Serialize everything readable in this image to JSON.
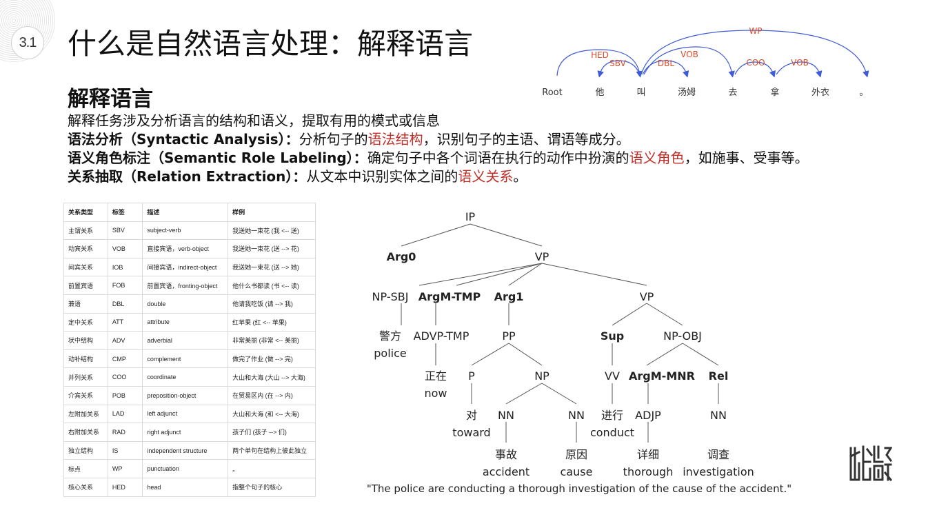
{
  "header": {
    "section_number": "3.1",
    "title": "什么是自然语言处理：解释语言"
  },
  "intro": {
    "heading": "解释语言",
    "line1": "解释任务涉及分析语言的结构和语义，提取有用的模式或信息",
    "syntactic": {
      "label": "语法分析（Syntactic Analysis）：",
      "pre": "分析句子的",
      "highlight": "语法结构",
      "post": "，识别句子的主语、谓语等成分。"
    },
    "srl": {
      "label": "语义角色标注（Semantic Role Labeling）：",
      "pre": "确定句子中各个词语在执行的动作中扮演的",
      "highlight": "语义角色",
      "post": "，如施事、受事等。"
    },
    "relation": {
      "label": "关系抽取（Relation Extraction）：",
      "pre": "从文本中识别实体之间的",
      "highlight": "语义关系",
      "post": "。"
    }
  },
  "dependency_diagram": {
    "tokens": [
      "Root",
      "他",
      "叫",
      "汤姆",
      "去",
      "拿",
      "外衣",
      "。"
    ],
    "arc_labels": [
      "HED",
      "SBV",
      "DBL",
      "VOB",
      "WP",
      "COO",
      "VOB"
    ],
    "colors": {
      "arc": "#3f5bd6",
      "label": "#d94a2a"
    }
  },
  "relation_table": {
    "headers": [
      "关系类型",
      "标签",
      "描述",
      "样例"
    ],
    "rows": [
      [
        "主谓关系",
        "SBV",
        "subject-verb",
        "我送她一束花 (我 <-- 送)"
      ],
      [
        "动宾关系",
        "VOB",
        "直接宾语，verb-object",
        "我送她一束花 (送 --> 花)"
      ],
      [
        "间宾关系",
        "IOB",
        "间接宾语，indirect-object",
        "我送她一束花 (送 --> 她)"
      ],
      [
        "前置宾语",
        "FOB",
        "前置宾语，fronting-object",
        "他什么书都读 (书 <-- 读)"
      ],
      [
        "兼语",
        "DBL",
        "double",
        "他请我吃饭 (请 --> 我)"
      ],
      [
        "定中关系",
        "ATT",
        "attribute",
        "红苹果 (红 <-- 苹果)"
      ],
      [
        "状中结构",
        "ADV",
        "adverbial",
        "非常美丽 (非常 <-- 美丽)"
      ],
      [
        "动补结构",
        "CMP",
        "complement",
        "做完了作业 (做 --> 完)"
      ],
      [
        "并列关系",
        "COO",
        "coordinate",
        "大山和大海 (大山 --> 大海)"
      ],
      [
        "介宾关系",
        "POB",
        "preposition-object",
        "在贸易区内 (在 --> 内)"
      ],
      [
        "左附加关系",
        "LAD",
        "left adjunct",
        "大山和大海 (和 <-- 大海)"
      ],
      [
        "右附加关系",
        "RAD",
        "right adjunct",
        "孩子们 (孩子 --> 们)"
      ],
      [
        "独立结构",
        "IS",
        "independent structure",
        "两个单句在结构上彼此独立"
      ],
      [
        "标点",
        "WP",
        "punctuation",
        "。"
      ],
      [
        "核心关系",
        "HED",
        "head",
        "指整个句子的核心"
      ]
    ]
  },
  "parse_tree": {
    "nodes": {
      "ip": "IP",
      "arg0": "Arg0",
      "vp1": "VP",
      "npsbj": "NP-SBJ",
      "argmtmp": "ArgM-TMP",
      "arg1": "Arg1",
      "vp2": "VP",
      "jingfang": "警方",
      "police": "police",
      "advptmp": "ADVP-TMP",
      "pp": "PP",
      "sup": "Sup",
      "npobj": "NP-OBJ",
      "zhengzai": "正在",
      "now": "now",
      "p": "P",
      "np": "NP",
      "vv": "VV",
      "argmmnr": "ArgM-MNR",
      "rel": "Rel",
      "dui": "对",
      "toward": "toward",
      "nn1": "NN",
      "nn2": "NN",
      "jinxing": "进行",
      "conduct": "conduct",
      "adjp": "ADJP",
      "nn3": "NN",
      "shigu": "事故",
      "accident": "accident",
      "yuanyin": "原因",
      "cause": "cause",
      "xiangxi": "详细",
      "thorough": "thorough",
      "diaocha": "调查",
      "investigation": "investigation"
    },
    "caption": "\"The police are conducting a thorough investigation of the cause of the accident.\""
  },
  "logo": {
    "icon": "calligraphy-seal-logo"
  }
}
